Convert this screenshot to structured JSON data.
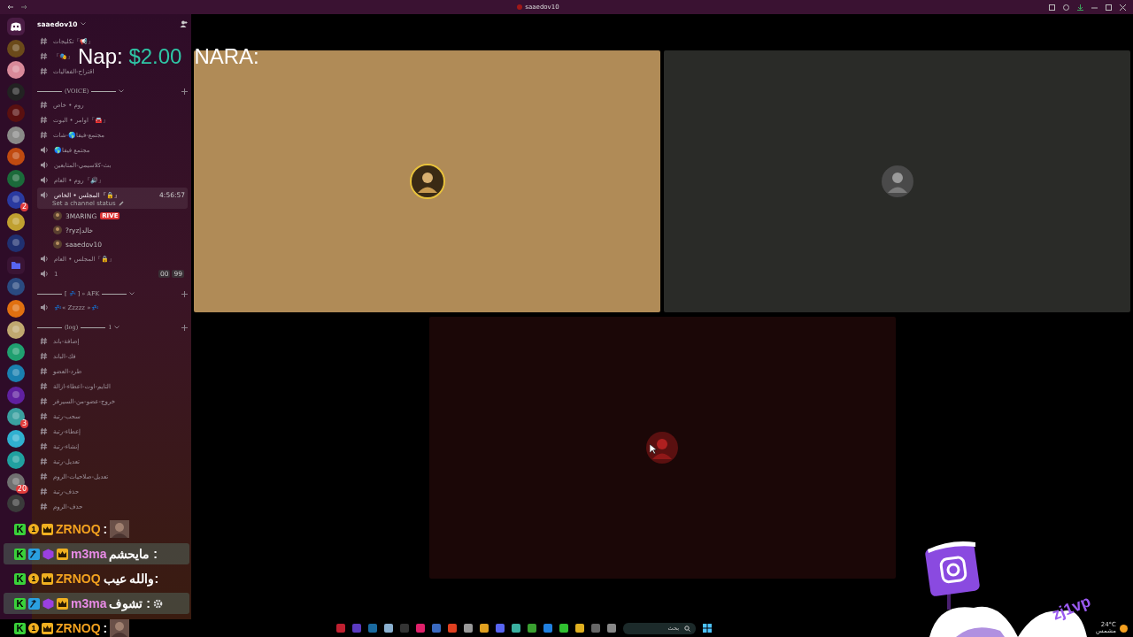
{
  "title_bar": {
    "title": "saaedov10"
  },
  "server_rail": [
    {
      "kind": "home"
    },
    {
      "kind": "server"
    },
    {
      "kind": "server"
    },
    {
      "kind": "server"
    },
    {
      "kind": "server"
    },
    {
      "kind": "server"
    },
    {
      "kind": "server"
    },
    {
      "kind": "server"
    },
    {
      "kind": "server",
      "badge": "2"
    },
    {
      "kind": "server"
    },
    {
      "kind": "server"
    },
    {
      "kind": "folder"
    },
    {
      "kind": "server"
    },
    {
      "kind": "server"
    },
    {
      "kind": "server"
    },
    {
      "kind": "server"
    },
    {
      "kind": "server"
    },
    {
      "kind": "server"
    },
    {
      "kind": "server",
      "badge": "3"
    },
    {
      "kind": "server"
    },
    {
      "kind": "server"
    },
    {
      "kind": "server",
      "badge": "20"
    },
    {
      "kind": "server"
    }
  ],
  "server": {
    "name": "saaedov10"
  },
  "channels": [
    {
      "kind": "text",
      "name": "『📢』تكليجات",
      "selected": false
    },
    {
      "kind": "text",
      "name": "『🎭』",
      "selected": false
    },
    {
      "kind": "text",
      "name": "اقتراح-الفعاليات",
      "selected": false
    },
    {
      "kind": "category",
      "name": "(VOICE)"
    },
    {
      "kind": "text",
      "name": "روم • خاص",
      "selected": false
    },
    {
      "kind": "text",
      "name": "『🚘』اوامر • البوت",
      "selected": false
    },
    {
      "kind": "text",
      "name": "مجتمع-فيفا🌎-شات",
      "selected": false
    },
    {
      "kind": "voice",
      "name": "مجتمع فيفا🌎",
      "selected": false
    },
    {
      "kind": "voice",
      "name": "بث-كلاسيمي-المتابعين",
      "selected": false
    },
    {
      "kind": "voice",
      "name": "『🔊』روم • العام",
      "selected": false
    },
    {
      "kind": "voice",
      "name": "『🔒』المجلس • الخاص",
      "selected": true,
      "timer": "4:56:57",
      "status": "Set a channel status",
      "members": [
        {
          "name": "3MARING",
          "tag": "RIVE"
        },
        {
          "name": "?ryz|خالد"
        },
        {
          "name": "saaedov10"
        }
      ]
    },
    {
      "kind": "voice",
      "name": "『🔒』المجلس • العام",
      "selected": false
    },
    {
      "kind": "voice",
      "name": "1",
      "selected": false,
      "counters": [
        "99",
        "00"
      ]
    },
    {
      "kind": "category",
      "name": "[ 💤 ] » AFK"
    },
    {
      "kind": "voice",
      "name": "💤« Zzzzz »💤",
      "selected": false
    },
    {
      "kind": "category",
      "name": "(log)",
      "suffix": "1"
    },
    {
      "kind": "text",
      "name": "إضافة-باند",
      "selected": false
    },
    {
      "kind": "text",
      "name": "فك-الباند",
      "selected": false
    },
    {
      "kind": "text",
      "name": "طرد-العضو",
      "selected": false
    },
    {
      "kind": "text",
      "name": "التايم-اوت-اعطاء-ازالة",
      "selected": false
    },
    {
      "kind": "text",
      "name": "خروج-عضو-من-السيرفر",
      "selected": false
    },
    {
      "kind": "text",
      "name": "سحب-رتبة",
      "selected": false
    },
    {
      "kind": "text",
      "name": "إعطاء-رتبة",
      "selected": false
    },
    {
      "kind": "text",
      "name": "إنشاء-رتبة",
      "selected": false
    },
    {
      "kind": "text",
      "name": "تعديل-رتبة",
      "selected": false
    },
    {
      "kind": "text",
      "name": "تعديل-صلاحيات-الروم",
      "selected": false
    },
    {
      "kind": "text",
      "name": "حذف-رتبة",
      "selected": false
    },
    {
      "kind": "text",
      "name": "حذف-الروم",
      "selected": false
    }
  ],
  "donation_overlay": {
    "label": "Nap:",
    "amount": "$2.00",
    "donor": "NARA:"
  },
  "streams": [
    {
      "color": "#b08b57",
      "speaking": true
    },
    {
      "color": "#2a2b28",
      "speaking": false
    },
    {
      "color": "#1b0707",
      "speaking": false,
      "cursor": true
    }
  ],
  "chat": [
    {
      "user": "ZRNOQ",
      "color": "#f3a21f",
      "badges": [
        {
          "kind": "crown"
        },
        {
          "kind": "number",
          "text": "1"
        },
        {
          "kind": "letter",
          "text": "K"
        }
      ],
      "message": ":",
      "emote": true,
      "highlighted": false
    },
    {
      "user": "m3ma",
      "color": "#e88be6",
      "badges": [
        {
          "kind": "crown"
        },
        {
          "kind": "gem"
        },
        {
          "kind": "hammer"
        },
        {
          "kind": "letter",
          "text": "K"
        }
      ],
      "message": ": مايحشم",
      "emote": false,
      "highlighted": true
    },
    {
      "user": "ZRNOQ",
      "color": "#f3a21f",
      "badges": [
        {
          "kind": "crown"
        },
        {
          "kind": "number",
          "text": "1"
        },
        {
          "kind": "letter",
          "text": "K"
        }
      ],
      "message": ":والله عيب",
      "emote": false,
      "highlighted": false
    },
    {
      "user": "m3ma",
      "color": "#e88be6",
      "badges": [
        {
          "kind": "crown"
        },
        {
          "kind": "gem"
        },
        {
          "kind": "hammer"
        },
        {
          "kind": "letter",
          "text": "K"
        }
      ],
      "message": ": تشوف",
      "emote": false,
      "highlighted": true,
      "gear": true
    },
    {
      "user": "ZRNOQ",
      "color": "#f3a21f",
      "badges": [
        {
          "kind": "crown"
        },
        {
          "kind": "number",
          "text": "1"
        },
        {
          "kind": "letter",
          "text": "K"
        }
      ],
      "message": ":",
      "emote": true,
      "highlighted": false
    }
  ],
  "taskbar": {
    "search": "بحث",
    "temperature": "24°C",
    "weather": "مشمس"
  },
  "sign": {
    "handle": "zj1vp"
  }
}
